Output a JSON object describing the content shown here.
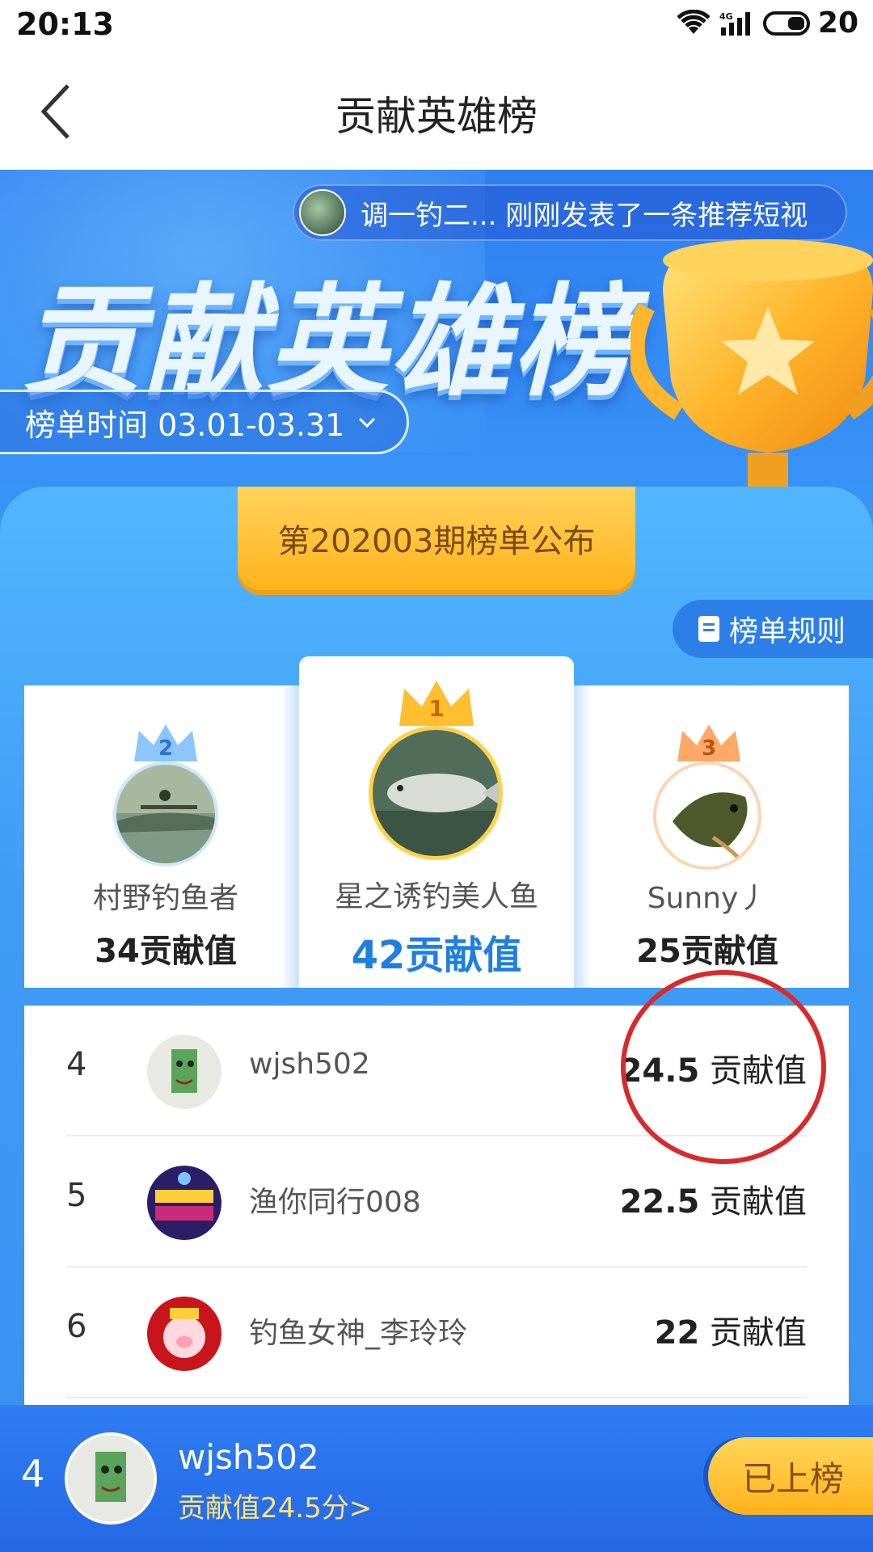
{
  "status_bar": {
    "time": "20:13",
    "network": "4G",
    "battery": "20"
  },
  "nav": {
    "title": "贡献英雄榜"
  },
  "hero": {
    "ticker": "调一钓二... 刚刚发表了一条推荐短视",
    "title": "贡献英雄榜",
    "period_label": "榜单时间 03.01-03.31"
  },
  "board": {
    "issue_banner": "第202003期榜单公布",
    "rules_label": "榜单规则",
    "podium": [
      {
        "rank": "2",
        "name": "村野钓鱼者",
        "score": "34",
        "unit": "贡献值"
      },
      {
        "rank": "1",
        "name": "星之诱钓美人鱼",
        "score": "42",
        "unit": "贡献值"
      },
      {
        "rank": "3",
        "name": "Sunny丿",
        "score": "25",
        "unit": "贡献值"
      }
    ],
    "list": [
      {
        "rank": "4",
        "name": "wjsh502",
        "score": "24.5",
        "unit": "贡献值"
      },
      {
        "rank": "5",
        "name": "渔你同行008",
        "score": "22.5",
        "unit": "贡献值"
      },
      {
        "rank": "6",
        "name": "钓鱼女神_李玲玲",
        "score": "22",
        "unit": "贡献值"
      }
    ]
  },
  "me": {
    "rank": "4",
    "name": "wjsh502",
    "score_text": "贡献值24.5分>",
    "status_button": "已上榜"
  },
  "colors": {
    "accent": "#2f7ff0",
    "gold": "#ffb21c",
    "annotation": "#d82a2a"
  }
}
